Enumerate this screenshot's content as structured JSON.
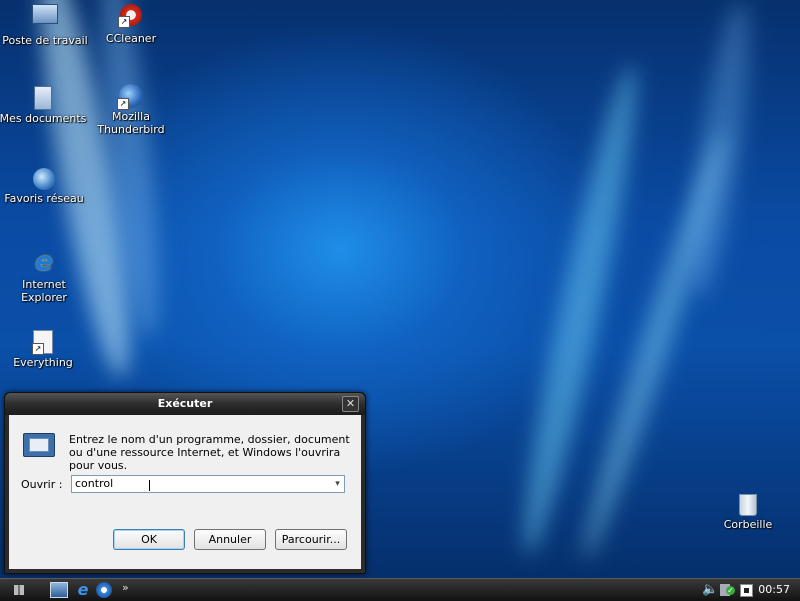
{
  "desktop": {
    "icons": [
      {
        "label": "Poste de travail"
      },
      {
        "label": "CCleaner"
      },
      {
        "label": "Mes documents"
      },
      {
        "label": "Mozilla Thunderbird"
      },
      {
        "label": "Favoris réseau"
      },
      {
        "label": "Internet Explorer"
      },
      {
        "label": "Everything"
      },
      {
        "label": "Corbeille"
      }
    ]
  },
  "run_dialog": {
    "title": "Exécuter",
    "description": "Entrez le nom d'un programme, dossier, document ou d'une ressource Internet, et Windows l'ouvrira pour vous.",
    "open_label": "Ouvrir :",
    "open_value": "control",
    "ok_label": "OK",
    "cancel_label": "Annuler",
    "browse_label": "Parcourir...",
    "close_glyph": "✕"
  },
  "taskbar": {
    "chevron": "»",
    "clock": "00:57"
  },
  "colors": {
    "accent": "#0a4ca5",
    "taskbar": "#1e1e1e"
  }
}
